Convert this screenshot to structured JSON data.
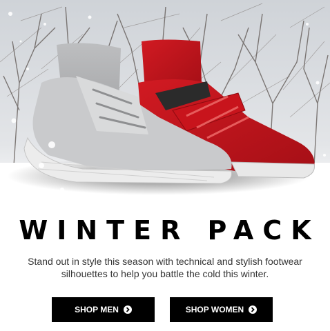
{
  "hero": {
    "image_icon": "winter-sneakers-hero-image",
    "colors": {
      "sky": "#d6d9dd",
      "grey_shoe": "#c9cacc",
      "red_shoe": "#c8141c",
      "dark_accent": "#2b2b2b"
    }
  },
  "headline": "WINTER PACK",
  "subtitle": "Stand out in style this season with technical and stylish footwear silhouettes to help you battle the cold this winter.",
  "buttons": {
    "shop_men": "SHOP MEN",
    "shop_women": "SHOP WOMEN",
    "icon": "arrow-right-circle-icon",
    "background": "#000000",
    "text_color": "#ffffff"
  }
}
